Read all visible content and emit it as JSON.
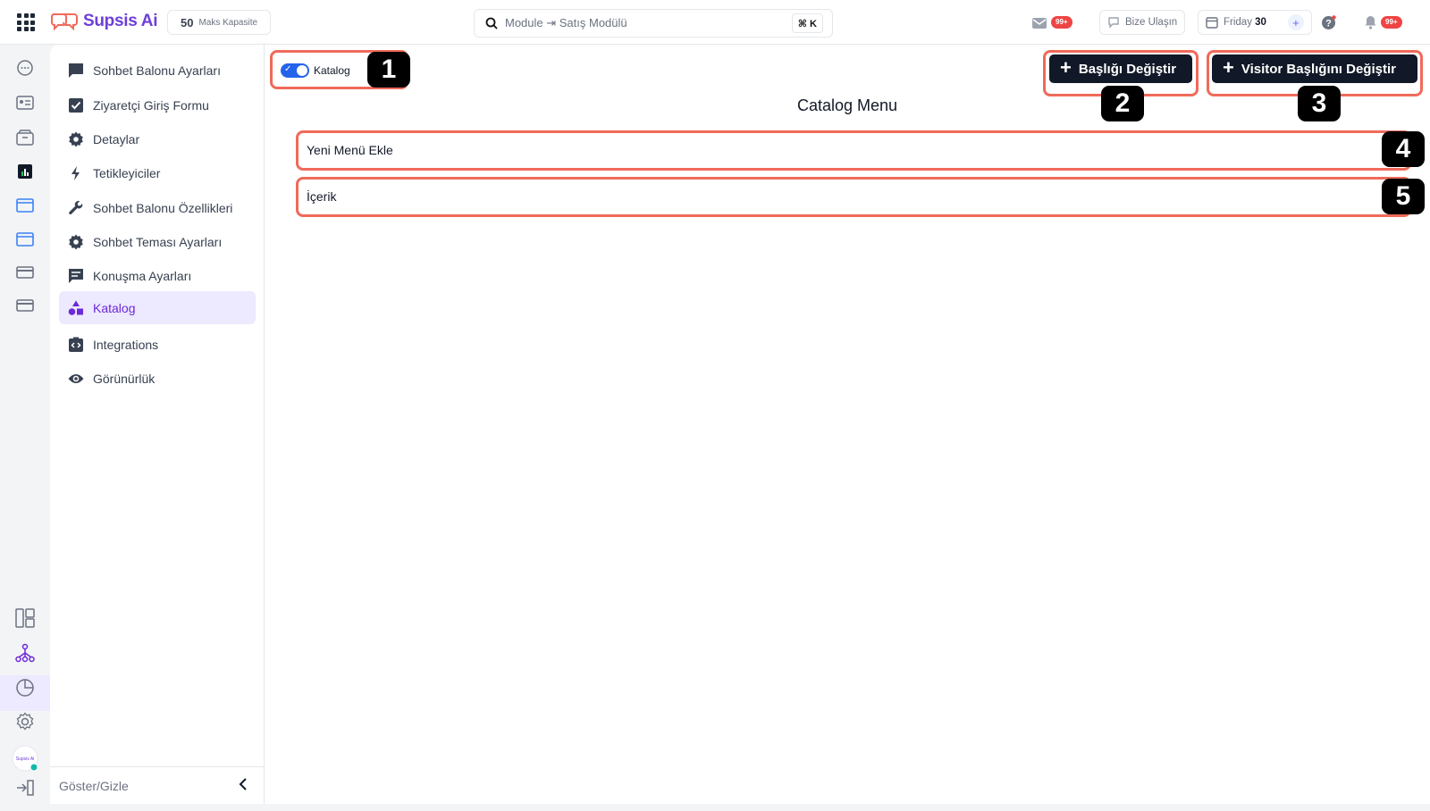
{
  "app": {
    "name": "Supsis Ai"
  },
  "topbar": {
    "capacity_number": "50",
    "capacity_label": "Maks Kapasite",
    "search_value": "Module ⇥ Satış Modülü",
    "shortcut": "⌘ K",
    "inbox_badge": "99+",
    "contact_label": "Bize Ulaşın",
    "date_day": "Friday",
    "date_num": "30",
    "notif_badge": "99+"
  },
  "rail": {
    "icons": [
      "chat-icon",
      "contacts-icon",
      "inbox-icon",
      "reports-icon",
      "window-icon",
      "window-icon-2",
      "card-icon",
      "card-icon-2"
    ],
    "bottom_icons": [
      "layout-icon",
      "org-chart-icon",
      "pie-chart-icon",
      "settings-icon",
      "avatar",
      "logout-icon"
    ]
  },
  "sidebar": {
    "items": [
      {
        "label": "Sohbet Balonu Ayarları",
        "icon": "chat-square-icon"
      },
      {
        "label": "Ziyaretçi Giriş Formu",
        "icon": "checkbox-icon"
      },
      {
        "label": "Detaylar",
        "icon": "gear-icon"
      },
      {
        "label": "Tetikleyiciler",
        "icon": "bolt-icon"
      },
      {
        "label": "Sohbet Balonu Özellikleri",
        "icon": "wrench-icon"
      },
      {
        "label": "Sohbet Teması Ayarları",
        "icon": "gear-icon"
      },
      {
        "label": "Konuşma Ayarları",
        "icon": "message-icon"
      },
      {
        "label": "Katalog",
        "icon": "shapes-icon"
      },
      {
        "label": "Integrations",
        "icon": "code-icon"
      },
      {
        "label": "Görünürlük",
        "icon": "eye-icon"
      }
    ],
    "active_index": 7,
    "footer_label": "Göster/Gizle"
  },
  "main": {
    "toggle_label": "Katalog",
    "toggle_on": true,
    "btn_change_title": "Başlığı Değiştir",
    "btn_change_visitor_title": "Visitor Başlığını Değiştir",
    "title": "Catalog Menu",
    "rows": [
      "Yeni Menü Ekle",
      "İçerik"
    ],
    "markers": [
      "1",
      "2",
      "3",
      "4",
      "5"
    ]
  },
  "colors": {
    "brand": "#6d3fd8",
    "highlight": "#f06a5a",
    "toggle": "#2563eb",
    "button_dark": "#111827",
    "badge": "#ef4444",
    "active_bg": "#ede9fe"
  }
}
